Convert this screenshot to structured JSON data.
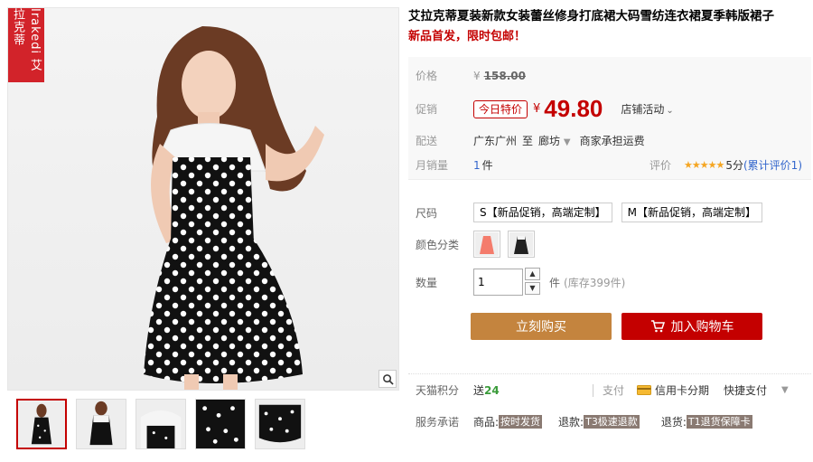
{
  "brand": {
    "logo_text": "Irakedi 艾拉克蒂"
  },
  "product": {
    "title": "艾拉克蒂夏装新款女装蕾丝修身打底裙大码雪纺连衣裙夏季韩版裙子",
    "subtitle": "新品首发，限时包邮！"
  },
  "price": {
    "label": "价格",
    "currency": "¥",
    "original": "158.00"
  },
  "promo": {
    "label": "促销",
    "badge": "今日特价",
    "currency": "¥",
    "price": "49.80",
    "shop_activity": "店铺活动",
    "chevron": "⌄"
  },
  "shipping": {
    "label": "配送",
    "from": "广东广州",
    "to_word": "至",
    "dest": "廊坊",
    "dest_caret": "▼",
    "fee": "商家承担运费"
  },
  "sales": {
    "label": "月销量",
    "count": "1",
    "unit": "件",
    "rating_label": "评价",
    "stars": "★★★★★",
    "rating_score": "5分",
    "rating_count": "(累计评价1)"
  },
  "sku": {
    "size_label": "尺码",
    "sizes": [
      "S【新品促销，高端定制】",
      "M【新品促销，高端定制】"
    ],
    "color_label": "颜色分类",
    "colors": [
      {
        "name": "coral-dress",
        "color": "#f47c6c"
      },
      {
        "name": "black-dress",
        "color": "#222222"
      }
    ]
  },
  "quantity": {
    "label": "数量",
    "value": "1",
    "up": "▲",
    "down": "▼",
    "unit": "件",
    "stock": "(库存399件)"
  },
  "actions": {
    "buy_now": "立刻购买",
    "add_cart": "加入购物车"
  },
  "points": {
    "label": "天猫积分",
    "text": "送",
    "value": "24"
  },
  "payment": {
    "label": "支付",
    "credit_installment": "信用卡分期",
    "express_pay": "快捷支付",
    "more_caret": "▼"
  },
  "service": {
    "label": "服务承诺",
    "goods_label": "商品:",
    "goods_tag": "按时发货",
    "refund_label": "退款:",
    "refund_tag": "T3极速退款",
    "return_label": "退货:",
    "return_tag": "T1退货保障卡"
  },
  "colors": {
    "accent_red": "#c40000",
    "buy_button": "#c4843e",
    "cart_button": "#c40000",
    "points_green": "#3a9b3a",
    "star_gold": "#f5a623"
  },
  "icons": [
    "zoom-icon",
    "cart-icon",
    "credit-card-icon",
    "chevron-down-icon"
  ]
}
